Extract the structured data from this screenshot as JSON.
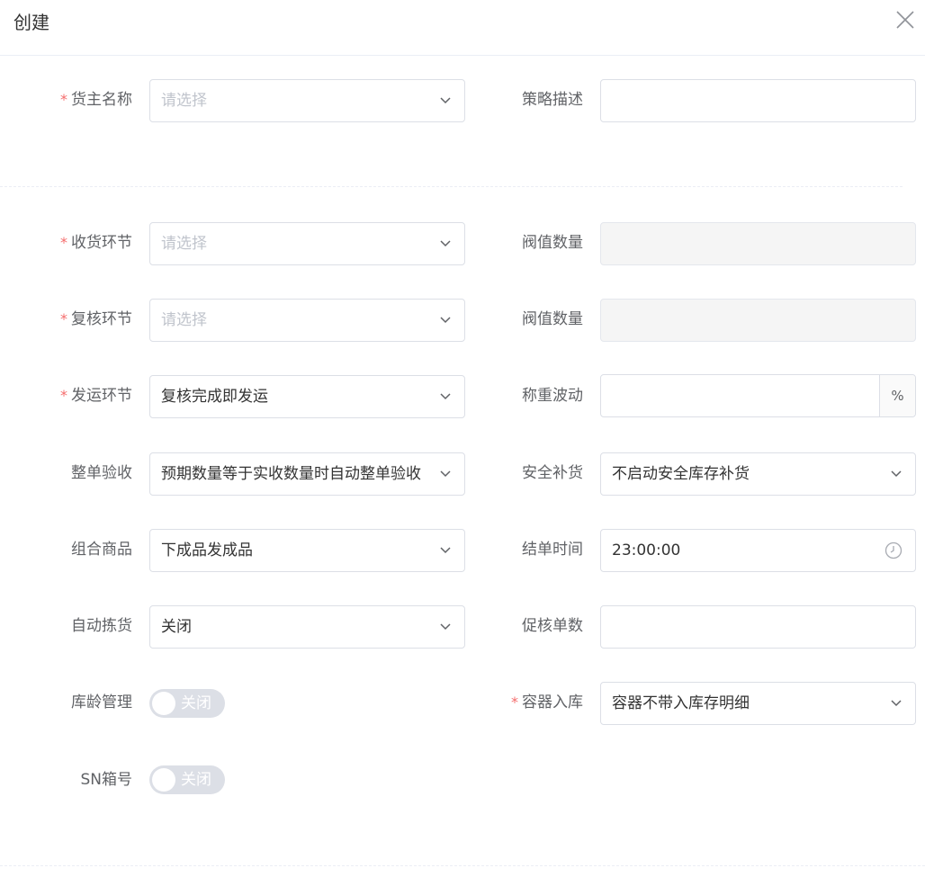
{
  "dialog": {
    "title": "创建"
  },
  "form": {
    "owner_name": {
      "label": "货主名称",
      "placeholder": "请选择"
    },
    "strategy_desc": {
      "label": "策略描述",
      "value": ""
    },
    "receive_step": {
      "label": "收货环节",
      "placeholder": "请选择"
    },
    "threshold_1": {
      "label": "阀值数量",
      "value": ""
    },
    "review_step": {
      "label": "复核环节",
      "placeholder": "请选择"
    },
    "threshold_2": {
      "label": "阀值数量",
      "value": ""
    },
    "ship_step": {
      "label": "发运环节",
      "value": "复核完成即发运"
    },
    "weight_fluct": {
      "label": "称重波动",
      "value": "",
      "suffix": "%"
    },
    "whole_accept": {
      "label": "整单验收",
      "value": "预期数量等于实收数量时自动整单验收"
    },
    "safety_replenish": {
      "label": "安全补货",
      "value": "不启动安全库存补货"
    },
    "combo_goods": {
      "label": "组合商品",
      "value": "下成品发成品"
    },
    "close_time": {
      "label": "结单时间",
      "value": "23:00:00"
    },
    "auto_pick": {
      "label": "自动拣货",
      "value": "关闭"
    },
    "urge_count": {
      "label": "促核单数",
      "value": ""
    },
    "stock_age": {
      "label": "库龄管理",
      "switch_text": "关闭",
      "on": false
    },
    "container_in": {
      "label": "容器入库",
      "value": "容器不带入库存明细"
    },
    "sn_box": {
      "label": "SN箱号",
      "switch_text": "关闭",
      "on": false
    }
  },
  "required_mark": "*",
  "icons": {
    "close": "close-icon",
    "chevron": "chevron-down-icon",
    "clock": "clock-icon"
  },
  "colors": {
    "required": "#f56c6c",
    "placeholder": "#c0c4cc",
    "switch_off": "#dcdfe6"
  }
}
